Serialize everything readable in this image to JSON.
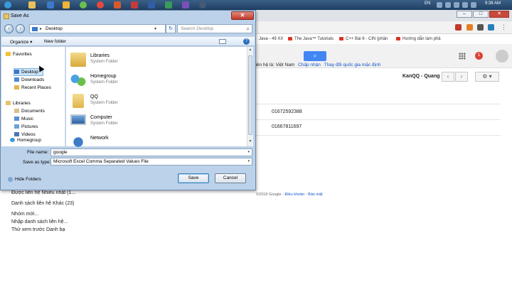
{
  "taskbar": {
    "language": "EN",
    "time": "9:38 AM"
  },
  "browser": {
    "bookmarks": [
      "Java - 49 XX",
      "The Java™ Tutorials",
      "C++ Bài 6 - CIN (phần",
      "Hướng dẫn làm phầ"
    ],
    "lang_notice": {
      "text": "liên hệ là: Việt Nam",
      "accept": "Chấp nhận",
      "change": "Thay đổi quốc gia mặc định"
    },
    "notification_count": "1",
    "account_name": "KanQQ - Quang",
    "phones": [
      "01672592388",
      "01667811697"
    ],
    "footer": {
      "copyright": "©2018 Google - ",
      "terms": "Điều khoản",
      "sep": " - ",
      "privacy": "Bảo mật"
    },
    "left_items": [
      "Được liên hệ Nhiều nhất (1...",
      "Danh sách liên hệ Khác (23)",
      "Nhóm mới...",
      "Nhập danh sách liên hệ...",
      "Thử xem trước Danh bạ"
    ]
  },
  "dialog": {
    "title": "Save As",
    "address": "Desktop",
    "search_placeholder": "Search Desktop",
    "organize": "Organize ▾",
    "new_folder": "New folder",
    "nav": {
      "favorites": "Favorites",
      "desktop": "Desktop",
      "downloads": "Downloads",
      "recent_places": "Recent Places",
      "libraries": "Libraries",
      "documents": "Documents",
      "music": "Music",
      "pictures": "Pictures",
      "videos": "Videos",
      "homegroup": "Homegroup"
    },
    "files": [
      {
        "name": "Libraries",
        "type": "System Folder"
      },
      {
        "name": "Homegroup",
        "type": "System Folder"
      },
      {
        "name": "QQ",
        "type": "System Folder"
      },
      {
        "name": "Computer",
        "type": "System Folder"
      },
      {
        "name": "Network",
        "type": ""
      }
    ],
    "file_name_label": "File name:",
    "file_name_value": "google",
    "save_type_label": "Save as type:",
    "save_type_value": "Microsoft Excel Comma Separated Values File",
    "hide_folders": "Hide Folders",
    "save_button": "Save",
    "cancel_button": "Cancel"
  }
}
